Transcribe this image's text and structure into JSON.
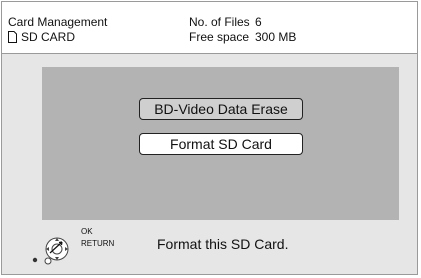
{
  "header": {
    "title": "Card Management",
    "device": "SD CARD",
    "info": [
      {
        "label": "No. of Files",
        "value": "6"
      },
      {
        "label": "Free space",
        "value": "300 MB"
      }
    ]
  },
  "menu": {
    "items": [
      {
        "label": "BD-Video Data Erase"
      },
      {
        "label": "Format SD Card"
      }
    ],
    "selected_index": 1
  },
  "footer": {
    "ok_label": "OK",
    "return_label": "RETURN",
    "status_text": "Format this SD Card."
  },
  "icons": {
    "device_icon": "document-icon",
    "remote_icon": "remote-dpad-icon"
  },
  "colors": {
    "background": "#e6e6e6",
    "panel": "#b3b3b3",
    "selected": "#ffffff",
    "unselected": "#cfcfcf"
  }
}
